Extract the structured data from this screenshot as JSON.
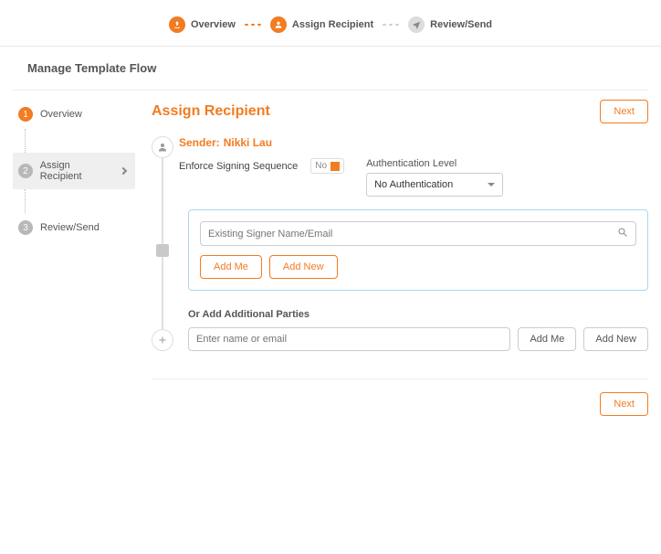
{
  "stepper": {
    "overview": "Overview",
    "assign": "Assign Recipient",
    "review": "Review/Send"
  },
  "page_title": "Manage Template Flow",
  "sidebar": {
    "items": [
      {
        "num": "1",
        "label": "Overview"
      },
      {
        "num": "2",
        "label": "Assign Recipient"
      },
      {
        "num": "3",
        "label": "Review/Send"
      }
    ]
  },
  "section": {
    "title": "Assign Recipient",
    "next": "Next"
  },
  "sender": {
    "label": "Sender:",
    "name": "Nikki Lau",
    "enforce_label": "Enforce Signing Sequence",
    "toggle_value": "No",
    "auth_label": "Authentication Level",
    "auth_value": "No Authentication"
  },
  "signer_box": {
    "search_placeholder": "Existing Signer Name/Email",
    "add_me": "Add Me",
    "add_new": "Add New"
  },
  "parties": {
    "heading": "Or Add Additional Parties",
    "placeholder": "Enter name or email",
    "add_me": "Add Me",
    "add_new": "Add New"
  },
  "footer": {
    "next": "Next"
  }
}
